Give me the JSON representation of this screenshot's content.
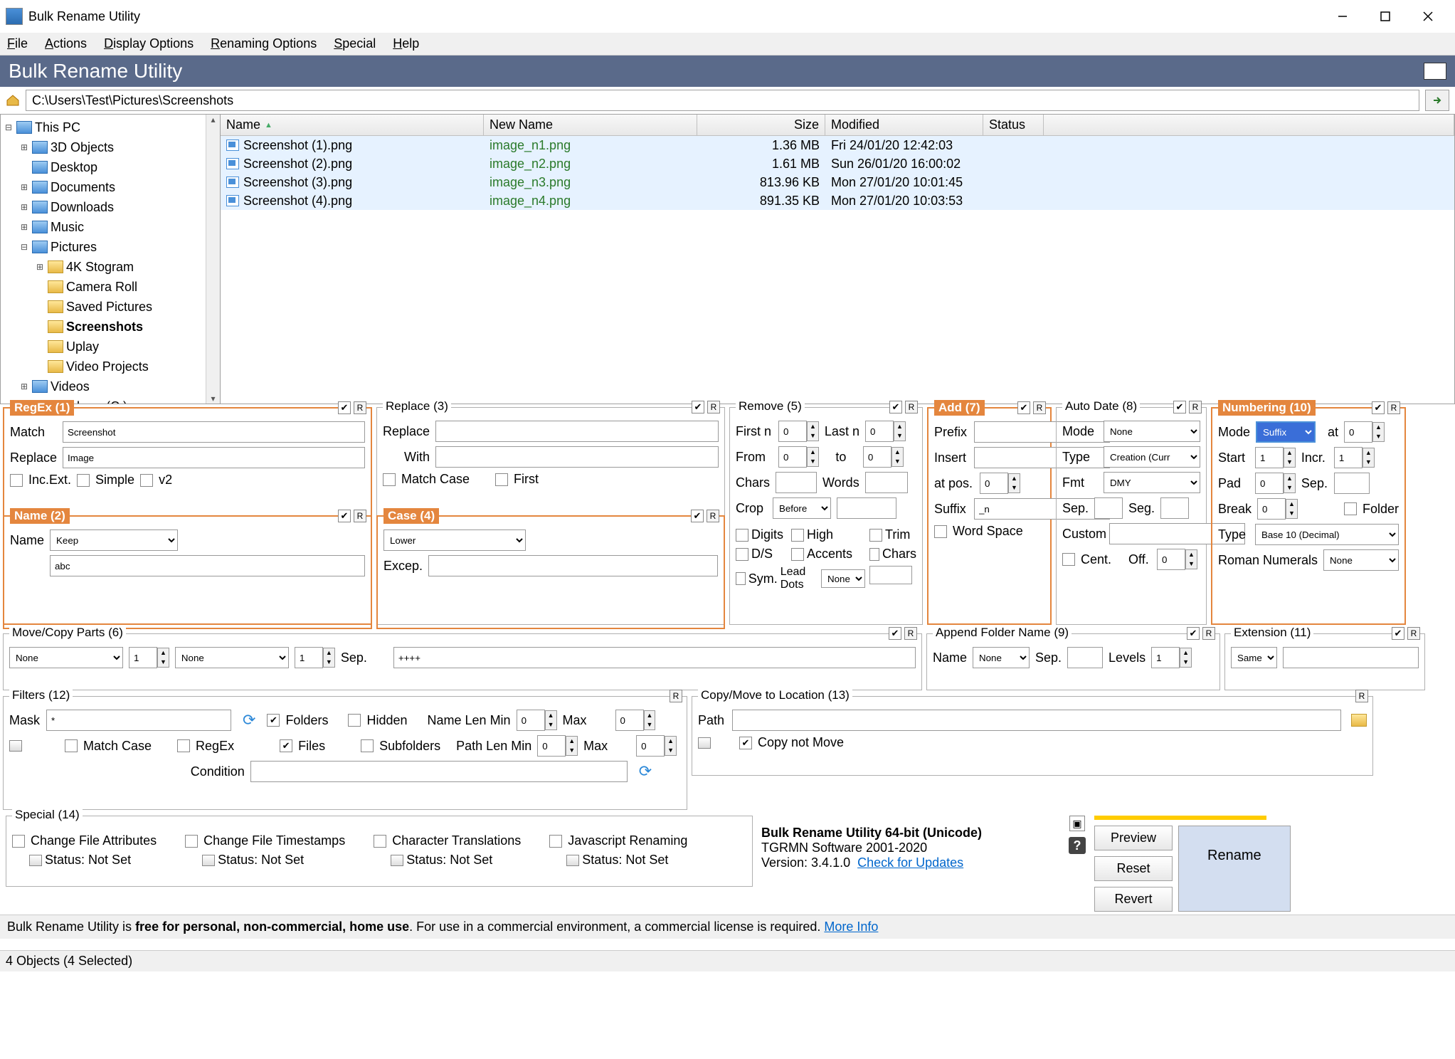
{
  "window_title": "Bulk Rename Utility",
  "menu": {
    "file": "File",
    "actions": "Actions",
    "display": "Display Options",
    "rename": "Renaming Options",
    "special": "Special",
    "help": "Help"
  },
  "brand": "Bulk Rename Utility",
  "path": "C:\\Users\\Test\\Pictures\\Screenshots",
  "tree": [
    {
      "depth": 0,
      "exp": "⊟",
      "icon": "pc",
      "label": "This PC"
    },
    {
      "depth": 1,
      "exp": "⊞",
      "icon": "blue",
      "label": "3D Objects"
    },
    {
      "depth": 1,
      "exp": "",
      "icon": "blue",
      "label": "Desktop"
    },
    {
      "depth": 1,
      "exp": "⊞",
      "icon": "blue",
      "label": "Documents"
    },
    {
      "depth": 1,
      "exp": "⊞",
      "icon": "blue",
      "label": "Downloads"
    },
    {
      "depth": 1,
      "exp": "⊞",
      "icon": "blue",
      "label": "Music"
    },
    {
      "depth": 1,
      "exp": "⊟",
      "icon": "blue",
      "label": "Pictures"
    },
    {
      "depth": 2,
      "exp": "⊞",
      "icon": "yellow",
      "label": "4K Stogram"
    },
    {
      "depth": 2,
      "exp": "",
      "icon": "yellow",
      "label": "Camera Roll"
    },
    {
      "depth": 2,
      "exp": "",
      "icon": "yellow",
      "label": "Saved Pictures"
    },
    {
      "depth": 2,
      "exp": "",
      "icon": "yellow",
      "label": "Screenshots",
      "bold": true
    },
    {
      "depth": 2,
      "exp": "",
      "icon": "yellow",
      "label": "Uplay"
    },
    {
      "depth": 2,
      "exp": "",
      "icon": "yellow",
      "label": "Video Projects"
    },
    {
      "depth": 1,
      "exp": "⊞",
      "icon": "blue",
      "label": "Videos"
    },
    {
      "depth": 1,
      "exp": "⊞",
      "icon": "drive",
      "label": "Windows (C:)"
    }
  ],
  "list_headers": {
    "name": "Name",
    "newname": "New Name",
    "size": "Size",
    "modified": "Modified",
    "status": "Status"
  },
  "rows": [
    {
      "name": "Screenshot (1).png",
      "newname": "image_n1.png",
      "size": "1.36 MB",
      "mod": "Fri 24/01/20 12:42:03"
    },
    {
      "name": "Screenshot (2).png",
      "newname": "image_n2.png",
      "size": "1.61 MB",
      "mod": "Sun 26/01/20 16:00:02"
    },
    {
      "name": "Screenshot (3).png",
      "newname": "image_n3.png",
      "size": "813.96 KB",
      "mod": "Mon 27/01/20 10:01:45"
    },
    {
      "name": "Screenshot (4).png",
      "newname": "image_n4.png",
      "size": "891.35 KB",
      "mod": "Mon 27/01/20 10:03:53"
    }
  ],
  "regex": {
    "title": "RegEx (1)",
    "match_lbl": "Match",
    "match": "Screenshot",
    "repl_lbl": "Replace",
    "repl": "Image",
    "incext": "Inc.Ext.",
    "simple": "Simple",
    "v2": "v2"
  },
  "namegrp": {
    "title": "Name (2)",
    "name_lbl": "Name",
    "sel": "Keep",
    "val": "abc"
  },
  "replace": {
    "title": "Replace (3)",
    "repl_lbl": "Replace",
    "with_lbl": "With",
    "matchcase": "Match Case",
    "first": "First"
  },
  "casegrp": {
    "title": "Case (4)",
    "sel": "Lower",
    "excep_lbl": "Excep."
  },
  "remove": {
    "title": "Remove (5)",
    "firstn": "First n",
    "lastn": "Last n",
    "firstn_v": "0",
    "lastn_v": "0",
    "from": "From",
    "to": "to",
    "from_v": "0",
    "to_v": "0",
    "chars": "Chars",
    "words": "Words",
    "crop": "Crop",
    "crop_sel": "Before",
    "digits": "Digits",
    "high": "High",
    "ds": "D/S",
    "accents": "Accents",
    "sym": "Sym.",
    "leaddots": "Lead Dots",
    "leaddots_sel": "None",
    "trim": "Trim",
    "chars_cb": "Chars",
    "chars_v": ""
  },
  "add": {
    "title": "Add (7)",
    "prefix": "Prefix",
    "insert": "Insert",
    "atpos": "at pos.",
    "atpos_v": "0",
    "suffix": "Suffix",
    "suffix_v": "_n",
    "wordspace": "Word Space"
  },
  "autodate": {
    "title": "Auto Date (8)",
    "mode": "Mode",
    "mode_sel": "None",
    "type": "Type",
    "type_sel": "Creation (Curr",
    "fmt": "Fmt",
    "fmt_sel": "DMY",
    "sep": "Sep.",
    "seg": "Seg.",
    "custom": "Custom",
    "cent": "Cent.",
    "off": "Off.",
    "off_v": "0"
  },
  "numbering": {
    "title": "Numbering (10)",
    "mode": "Mode",
    "mode_sel": "Suffix",
    "at": "at",
    "at_v": "0",
    "start": "Start",
    "start_v": "1",
    "incr": "Incr.",
    "incr_v": "1",
    "pad": "Pad",
    "pad_v": "0",
    "sep": "Sep.",
    "break": "Break",
    "break_v": "0",
    "folder": "Folder",
    "type": "Type",
    "type_sel": "Base 10 (Decimal)",
    "roman": "Roman Numerals",
    "roman_sel": "None"
  },
  "movecopy": {
    "title": "Move/Copy Parts (6)",
    "none1": "None",
    "v1": "1",
    "none2": "None",
    "v2": "1",
    "sep": "Sep.",
    "sep_v": "++++"
  },
  "appfolder": {
    "title": "Append Folder Name (9)",
    "name": "Name",
    "sel": "None",
    "sep": "Sep.",
    "levels": "Levels",
    "levels_v": "1"
  },
  "ext": {
    "title": "Extension (11)",
    "sel": "Same"
  },
  "filters": {
    "title": "Filters (12)",
    "mask": "Mask",
    "mask_v": "*",
    "folders": "Folders",
    "hidden": "Hidden",
    "nlmin": "Name Len Min",
    "nlmin_v": "0",
    "max": "Max",
    "max_v": "0",
    "matchcase": "Match Case",
    "regex": "RegEx",
    "files": "Files",
    "subfolders": "Subfolders",
    "plmin": "Path Len Min",
    "plmin_v": "0",
    "max2_v": "0",
    "condition": "Condition"
  },
  "copymove": {
    "title": "Copy/Move to Location (13)",
    "path": "Path",
    "copynotmove": "Copy not Move"
  },
  "specialgrp": {
    "title": "Special (14)",
    "cfa": "Change File Attributes",
    "cft": "Change File Timestamps",
    "ct": "Character Translations",
    "jr": "Javascript Renaming",
    "status": "Status:",
    "notset": "Not Set"
  },
  "about": {
    "prod": "Bulk Rename Utility 64-bit (Unicode)",
    "co": "TGRMN Software 2001-2020",
    "ver": "Version: 3.4.1.0",
    "chk": "Check for Updates"
  },
  "buttons": {
    "preview": "Preview",
    "reset": "Reset",
    "revert": "Revert",
    "rename": "Rename"
  },
  "footer": {
    "t1": "Bulk Rename Utility is ",
    "t2": "free for personal, non-commercial, home use",
    "t3": ". For use in a commercial environment, a commercial license is required. ",
    "more": "More Info"
  },
  "status": "4 Objects (4 Selected)"
}
